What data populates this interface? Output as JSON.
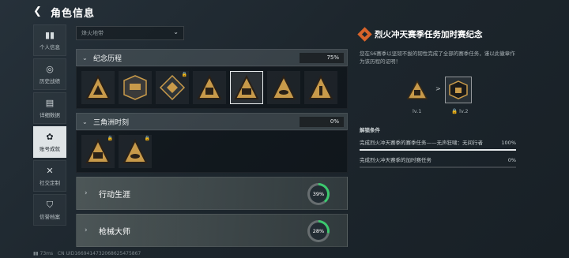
{
  "header": {
    "title": "角色信息"
  },
  "sidebar": {
    "items": [
      {
        "label": "个人信息",
        "icon": "bar-chart-icon",
        "glyph": "▮▮"
      },
      {
        "label": "历史战绩",
        "icon": "target-icon",
        "glyph": "◎"
      },
      {
        "label": "详细数据",
        "icon": "document-icon",
        "glyph": "▤"
      },
      {
        "label": "账号成就",
        "icon": "medal-icon",
        "glyph": "✿"
      },
      {
        "label": "社交定制",
        "icon": "crossed-tools-icon",
        "glyph": "✕"
      },
      {
        "label": "信誉档案",
        "icon": "shield-heart-icon",
        "glyph": "⛉"
      }
    ],
    "active_index": 3
  },
  "filter": {
    "value": "烽火地带"
  },
  "categories": [
    {
      "name": "纪念历程",
      "progress": "75%",
      "badges": 7,
      "locked": [
        2
      ],
      "selected": 4
    },
    {
      "name": "三角洲时刻",
      "progress": "0%",
      "badges": 2,
      "locked": [
        0,
        1
      ]
    }
  ],
  "collapsed": [
    {
      "name": "行动生涯",
      "progress": "39%",
      "fraction": 0.39
    },
    {
      "name": "枪械大师",
      "progress": "28%",
      "fraction": 0.28
    }
  ],
  "detail": {
    "title": "烈火冲天赛季任务加时赛纪念",
    "description": "您在S6赛季以坚韧不拔的韧性完成了全部的赛季任务，谨以此徽章作为该历程的证明！",
    "level1": "lv.1",
    "level2": "lv.2",
    "arrow": ">",
    "conditions_title": "解锁条件",
    "conditions": [
      {
        "text": "完成烈火冲天赛季的赛季任务——无声狂啸：无间行者",
        "pct": "100%",
        "fraction": 1.0
      },
      {
        "text": "完成烈火冲天赛季的加时赛任务",
        "pct": "0%",
        "fraction": 0.0
      }
    ]
  },
  "footer": {
    "ping": "73ms",
    "uid": "CN UID1669414732068625475867"
  },
  "colors": {
    "accent": "#d8632a",
    "ring_green": "#3cc86e",
    "badge_gold": "#c89a4a"
  }
}
